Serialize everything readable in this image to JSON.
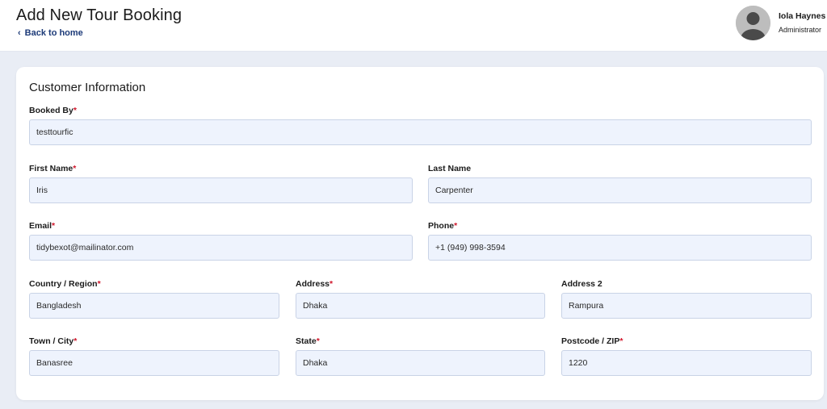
{
  "header": {
    "title": "Add New Tour Booking",
    "back_label": "Back to home",
    "back_icon": "chevron-left-icon",
    "user": {
      "name": "Iola Haynes",
      "role": "Administrator",
      "avatar_icon": "user-avatar-icon"
    }
  },
  "form": {
    "section_title": "Customer Information",
    "required_mark": "*",
    "fields": {
      "booked_by": {
        "label": "Booked By",
        "required": true,
        "value": "testtourfic"
      },
      "first_name": {
        "label": "First Name",
        "required": true,
        "value": "Iris"
      },
      "last_name": {
        "label": "Last Name",
        "required": false,
        "value": "Carpenter"
      },
      "email": {
        "label": "Email",
        "required": true,
        "value": "tidybexot@mailinator.com"
      },
      "phone": {
        "label": "Phone",
        "required": true,
        "value": "+1 (949) 998-3594"
      },
      "country": {
        "label": "Country / Region",
        "required": true,
        "value": "Bangladesh"
      },
      "address": {
        "label": "Address",
        "required": true,
        "value": "Dhaka"
      },
      "address2": {
        "label": "Address 2",
        "required": false,
        "value": "Rampura"
      },
      "town": {
        "label": "Town / City",
        "required": true,
        "value": "Banasree"
      },
      "state": {
        "label": "State",
        "required": true,
        "value": "Dhaka"
      },
      "postcode": {
        "label": "Postcode / ZIP",
        "required": true,
        "value": "1220"
      }
    }
  },
  "colors": {
    "accent": "#1c3a78",
    "required": "#d0162b",
    "input_bg": "#eef3fd",
    "page_bg": "#e9edf5"
  }
}
